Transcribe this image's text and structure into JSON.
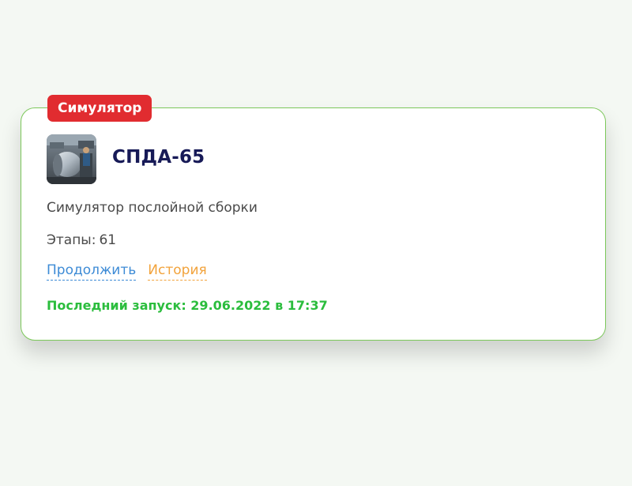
{
  "card": {
    "badge": "Симулятор",
    "title": "СПДА-65",
    "description": "Симулятор послойной сборки",
    "stages": {
      "label": "Этапы:",
      "value": "61"
    },
    "actions": {
      "continue_label": "Продолжить",
      "history_label": "История"
    },
    "last_run": "Последний запуск: 29.06.2022 в 17:37"
  },
  "colors": {
    "badge_bg": "#e12c30",
    "card_border": "#7cc85a",
    "title": "#171a57",
    "continue_link": "#3d8bd6",
    "history_link": "#f2a33c",
    "last_run": "#2bbd3d"
  },
  "thumbnail": {
    "icon": "machine-photo"
  }
}
